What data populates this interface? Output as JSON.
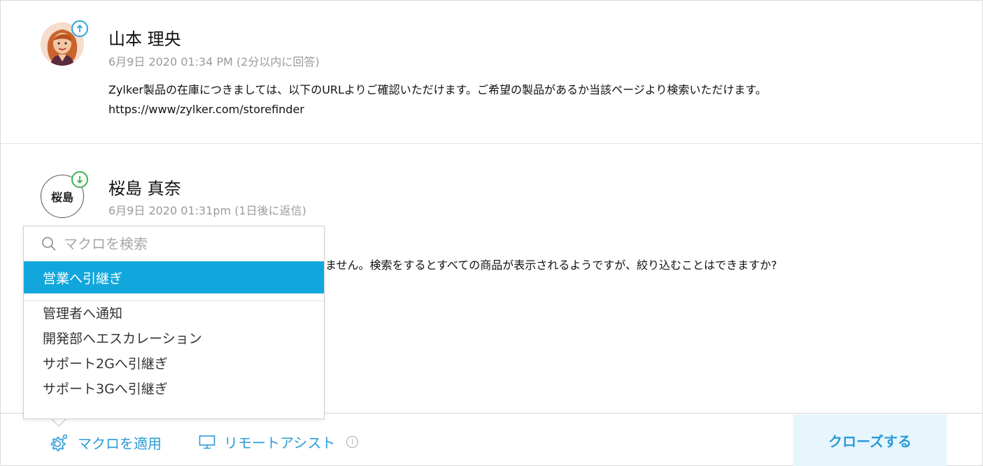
{
  "threads": [
    {
      "author": "山本 理央",
      "meta": "6月9日 2020 01:34 PM (2分以内に回答)",
      "lines": [
        "Zylker製品の在庫につきましては、以下のURLよりご確認いただけます。ご希望の製品があるか当該ページより検索いただけます。",
        "https://www/zylker.com/storefinder"
      ],
      "direction": "outgoing",
      "badge_color": "#2aa6db"
    },
    {
      "author": "桜島 真奈",
      "avatar_initials": "桜島",
      "meta": "6月9日 2020 01:31pm (1日後に返信)",
      "lines": [
        "ません。検索をするとすべての商品が表示されるようですが、絞り込むことはできますか?"
      ],
      "direction": "incoming",
      "badge_color": "#3fb34f"
    }
  ],
  "macro_dropdown": {
    "search_placeholder": "マクロを検索",
    "items": [
      {
        "label": "営業へ引継ぎ",
        "selected": true
      },
      {
        "label": "管理者へ通知",
        "selected": false
      },
      {
        "label": "開発部へエスカレーション",
        "selected": false
      },
      {
        "label": "サポート2Gへ引継ぎ",
        "selected": false
      },
      {
        "label": "サポート3Gへ引継ぎ",
        "selected": false
      }
    ],
    "highlight_color": "#12a7dc"
  },
  "actions": {
    "apply_macro": "マクロを適用",
    "remote_assist": "リモートアシスト",
    "close": "クローズする"
  },
  "colors": {
    "accent": "#2b9bd8",
    "close_bg": "#e7f5fc"
  },
  "icons": {
    "apply_macro": "gear-icon",
    "remote_assist": "monitor-icon",
    "info": "info-icon",
    "search": "search-icon"
  }
}
